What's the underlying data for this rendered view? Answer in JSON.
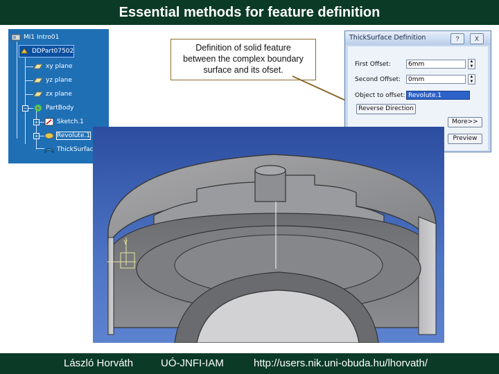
{
  "slide": {
    "title": "Essential methods for feature definition",
    "footer": {
      "author": "László Horváth",
      "institute": "UÓ-JNFI-IAM",
      "url": "http://users.nik.uni-obuda.hu/lhorvath/"
    }
  },
  "tree": {
    "items": [
      {
        "label": "MI1 Intro01",
        "icon": "product-icon"
      },
      {
        "label": "DDPart07502",
        "icon": "part-icon"
      },
      {
        "label": "xy plane",
        "icon": "plane-icon"
      },
      {
        "label": "yz plane",
        "icon": "plane-icon"
      },
      {
        "label": "zx plane",
        "icon": "plane-icon"
      },
      {
        "label": "PartBody",
        "icon": "gear-icon"
      },
      {
        "label": "Sketch.1",
        "icon": "sketch-icon"
      },
      {
        "label": "Revolute.1",
        "icon": "revolute-icon"
      },
      {
        "label": "ThickSurface",
        "icon": "thick-surface-icon"
      }
    ]
  },
  "callout": {
    "line1": "Definition of solid feature",
    "line2": "between the complex boundary",
    "line3": "surface and its ofset."
  },
  "dialog": {
    "title": "ThickSurface Definition",
    "help_label": "?",
    "close_label": "X",
    "first_offset_label": "First Offset:",
    "first_offset_value": "6mm",
    "second_offset_label": "Second Offset:",
    "second_offset_value": "0mm",
    "object_label": "Object to offset:",
    "object_value": "Revolute.1",
    "reverse_button": "Reverse Direction",
    "more_button": "More>>",
    "preview_button": "Preview"
  },
  "colors": {
    "title_bar": "#0b3a26",
    "tree_bg": "#1f6fb5",
    "viewport_bg": "#3e63b6",
    "callout_border": "#8b6a2c"
  }
}
